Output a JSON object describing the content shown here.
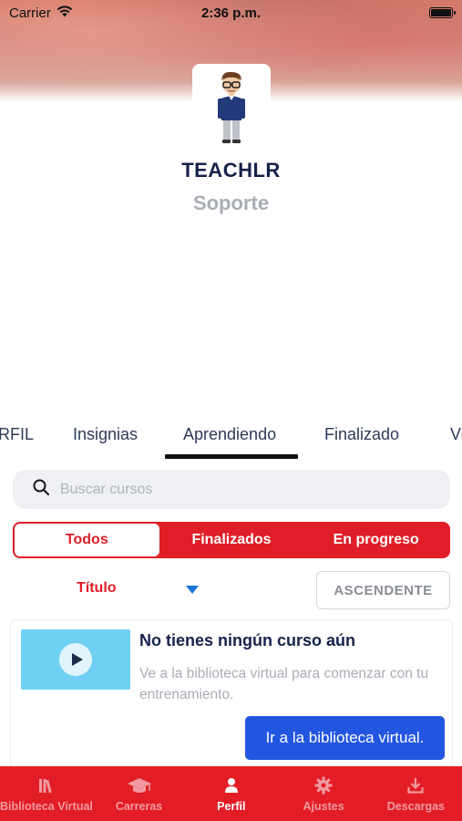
{
  "status_bar": {
    "carrier": "Carrier",
    "time": "2:36 p.m."
  },
  "profile": {
    "name": "TEACHLR",
    "role": "Soporte"
  },
  "tabs": [
    {
      "label": "RFIL"
    },
    {
      "label": "Insignias"
    },
    {
      "label": "Aprendiendo",
      "active": true
    },
    {
      "label": "Finalizado"
    },
    {
      "label": "Vi"
    }
  ],
  "search": {
    "placeholder": "Buscar cursos"
  },
  "filter": {
    "segments": [
      {
        "label": "Todos",
        "active": true
      },
      {
        "label": "Finalizados"
      },
      {
        "label": "En progreso"
      }
    ]
  },
  "sort": {
    "field_label": "Título",
    "order_label": "ASCENDENTE"
  },
  "empty_state": {
    "title": "No tienes ningún curso aún",
    "description": "Ve a la biblioteca virtual para comenzar con tu entrenamiento.",
    "button_label": "Ir a la biblioteca virtual."
  },
  "bottom_nav": [
    {
      "label": "Biblioteca Virtual",
      "icon": "books-icon"
    },
    {
      "label": "Carreras",
      "icon": "graduation-cap-icon"
    },
    {
      "label": "Perfil",
      "icon": "person-icon",
      "active": true
    },
    {
      "label": "Ajustes",
      "icon": "gear-icon"
    },
    {
      "label": "Descargas",
      "icon": "download-icon"
    }
  ],
  "colors": {
    "brand_red": "#e21d26",
    "primary_blue": "#2356e0",
    "navy": "#16224a"
  }
}
